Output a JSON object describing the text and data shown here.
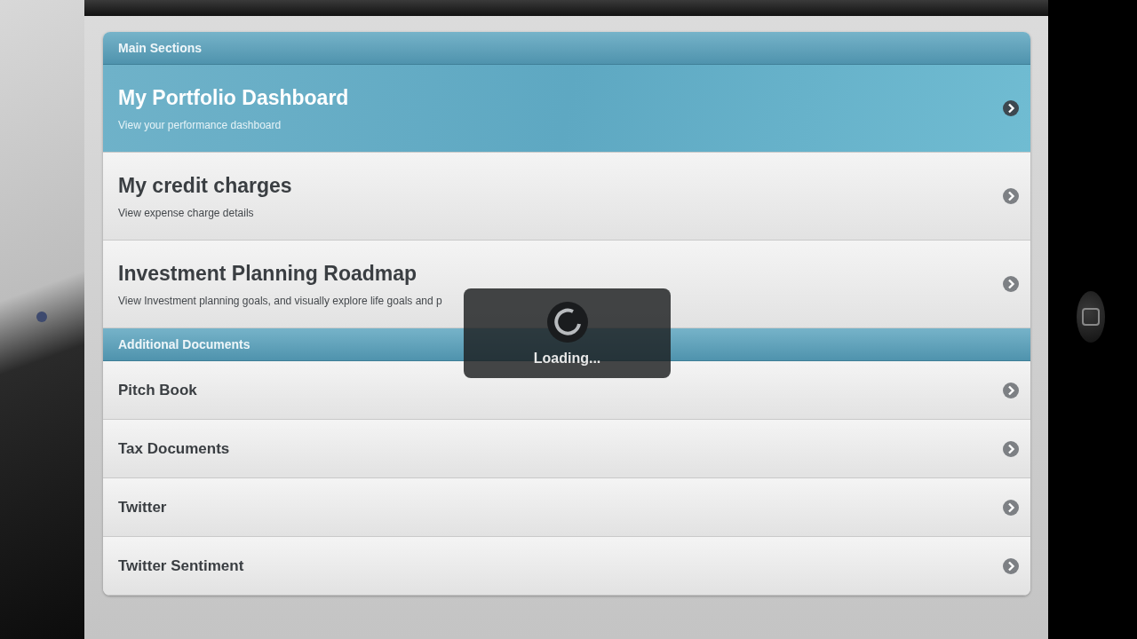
{
  "sections": [
    {
      "header": "Main Sections",
      "items": [
        {
          "title": "My Portfolio Dashboard",
          "subtitle": "View your performance dashboard",
          "selected": true
        },
        {
          "title": "My credit charges",
          "subtitle": "View expense charge details",
          "selected": false
        },
        {
          "title": "Investment Planning Roadmap",
          "subtitle": "View Investment planning goals, and visually explore life goals and p",
          "selected": false
        }
      ]
    },
    {
      "header": "Additional Documents",
      "items": [
        {
          "title": "Pitch Book",
          "selected": false
        },
        {
          "title": "Tax Documents",
          "selected": false
        },
        {
          "title": "Twitter",
          "selected": false
        },
        {
          "title": "Twitter Sentiment",
          "selected": false
        }
      ]
    }
  ],
  "loading": {
    "label": "Loading..."
  }
}
